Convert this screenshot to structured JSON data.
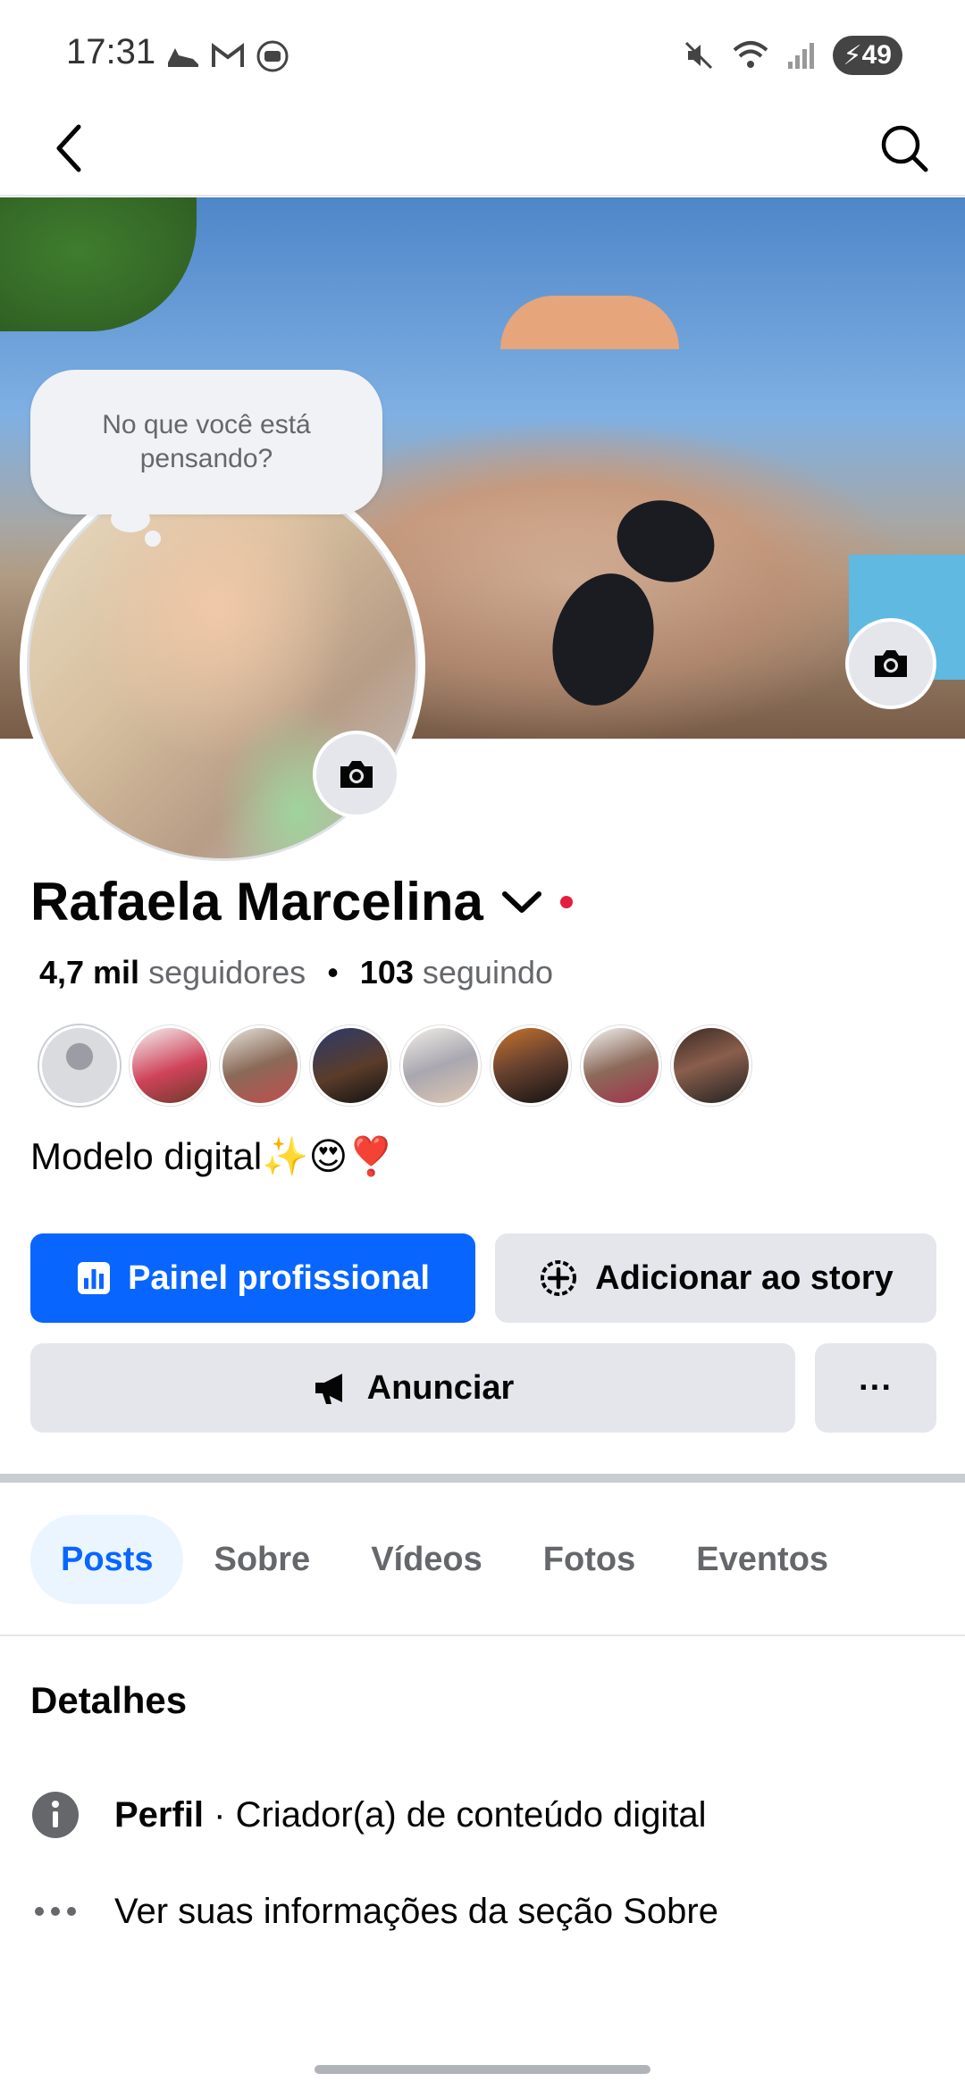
{
  "status_bar": {
    "time": "17:31",
    "notification_icons": [
      "shoe-icon",
      "gmail-icon",
      "radio-icon"
    ],
    "system_icons": [
      "mute-icon",
      "wifi-icon",
      "signal-icon"
    ],
    "battery": "49"
  },
  "top_bar": {
    "back_icon": "chevron-left-icon",
    "search_icon": "search-icon"
  },
  "profile": {
    "thought_bubble": "No que você está pensando?",
    "name": "Rafaela Marcelina",
    "followers_count": "4,7 mil",
    "followers_label": "seguidores",
    "following_count": "103",
    "following_label": "seguindo",
    "bio": "Modelo digital✨😍❣️"
  },
  "buttons": {
    "dashboard": "Painel profissional",
    "add_story": "Adicionar ao story",
    "advertise": "Anunciar",
    "more": "···"
  },
  "tabs": [
    {
      "label": "Posts",
      "active": true
    },
    {
      "label": "Sobre",
      "active": false
    },
    {
      "label": "Vídeos",
      "active": false
    },
    {
      "label": "Fotos",
      "active": false
    },
    {
      "label": "Eventos",
      "active": false
    }
  ],
  "details": {
    "title": "Detalhes",
    "profile_label": "Perfil",
    "profile_value": " · Criador(a) de conteúdo digital",
    "about_link": "Ver suas informações da seção Sobre"
  },
  "colors": {
    "primary": "#0866ff",
    "button_gray": "#e4e6eb",
    "secondary_text": "#65676b",
    "active_tab_bg": "#ebf5ff"
  }
}
